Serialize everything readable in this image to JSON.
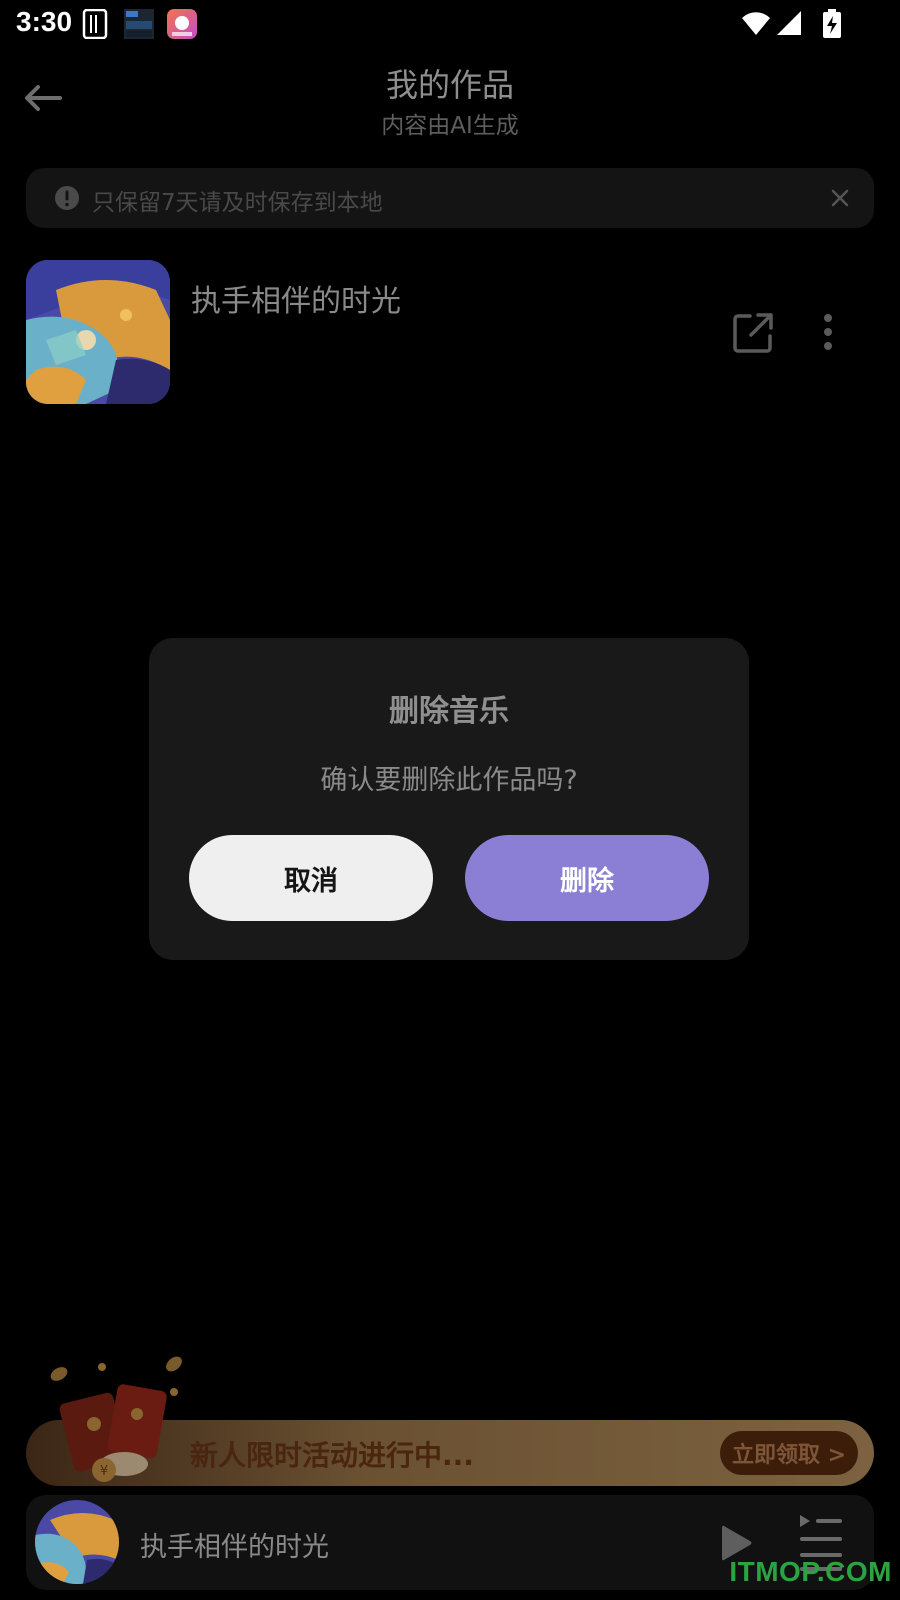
{
  "status_bar": {
    "time": "3:30",
    "icons": [
      "sim-card-icon",
      "calendar-app-icon",
      "app-notification-icon",
      "wifi-icon",
      "signal-icon",
      "battery-charging-icon"
    ]
  },
  "header": {
    "title": "我的作品",
    "subtitle": "内容由AI生成",
    "back_icon": "arrow-left-icon"
  },
  "notice": {
    "text": "只保留7天请及时保存到本地",
    "icon": "exclamation-circle-icon",
    "close_icon": "close-icon"
  },
  "works": [
    {
      "title": "执手相伴的时光",
      "share_icon": "share-external-icon",
      "more_icon": "more-vertical-icon"
    }
  ],
  "dialog": {
    "title": "删除音乐",
    "message": "确认要删除此作品吗?",
    "cancel_label": "取消",
    "delete_label": "删除"
  },
  "promo": {
    "text": "新人限时活动进行中...",
    "button_label": "立即领取 >"
  },
  "player": {
    "title": "执手相伴的时光",
    "play_icon": "play-icon",
    "playlist_icon": "playlist-icon"
  },
  "watermark": "ITMOP.COM",
  "colors": {
    "background": "#000000",
    "accent": "#8a7fd4",
    "dialog_bg": "#191919",
    "promo_text": "#4a2510"
  }
}
